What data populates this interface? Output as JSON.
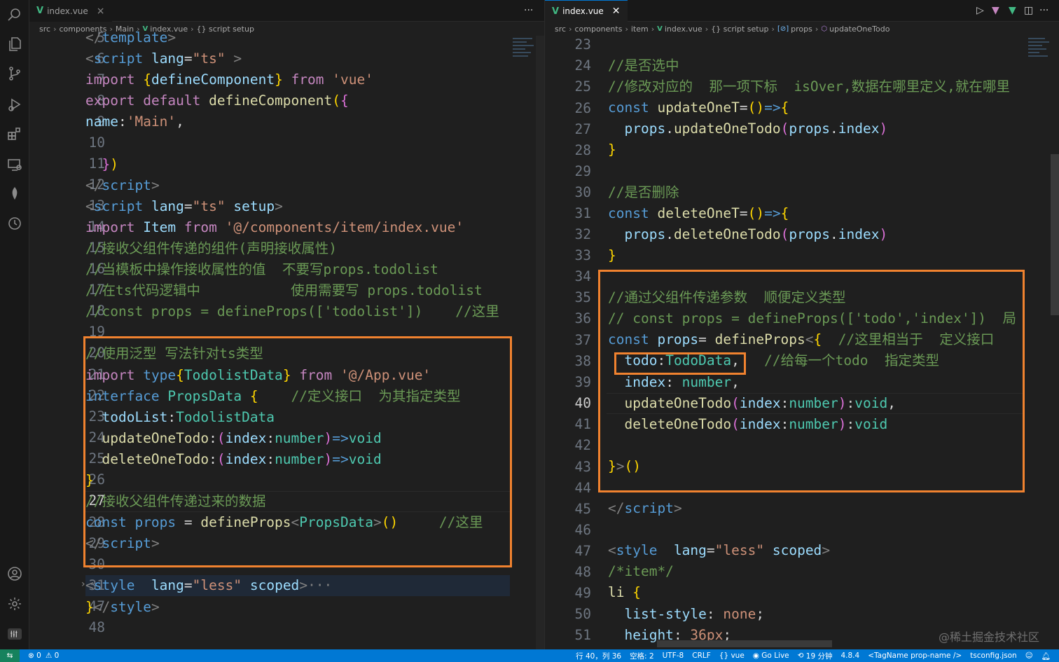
{
  "activity_bar": {
    "icons": [
      "search-icon",
      "files-icon",
      "source-control-icon",
      "run-debug-icon",
      "extensions-icon",
      "remote-explorer-icon",
      "mongodb-leaf-icon",
      "timeline-icon",
      "account-icon",
      "settings-gear-icon",
      "remote-indicator-icon"
    ]
  },
  "left": {
    "tab": {
      "label": "index.vue",
      "close": "×"
    },
    "tab_actions": "···",
    "breadcrumb": [
      "src",
      "components",
      "Main",
      "index.vue",
      "{} script setup"
    ],
    "line_numbers": [
      "5",
      "6",
      "7",
      "8",
      "9",
      "10",
      "11",
      "12",
      "13",
      "14",
      "15",
      "16",
      "17",
      "18",
      "19",
      "20",
      "21",
      "22",
      "23",
      "24",
      "25",
      "26",
      "27",
      "28",
      "29",
      "30",
      "31",
      "47",
      "48"
    ],
    "current_line": "27"
  },
  "right": {
    "tab": {
      "label": "index.vue",
      "close": "✕"
    },
    "breadcrumb": [
      "src",
      "components",
      "item",
      "index.vue",
      "{} script setup",
      "props",
      "updateOneTodo"
    ],
    "line_numbers": [
      "23",
      "24",
      "25",
      "26",
      "27",
      "28",
      "29",
      "30",
      "31",
      "32",
      "33",
      "34",
      "35",
      "36",
      "37",
      "38",
      "39",
      "40",
      "41",
      "42",
      "43",
      "44",
      "45",
      "46",
      "47",
      "48",
      "49",
      "50",
      "51"
    ],
    "current_line": "40"
  },
  "toolbar": {
    "run": "▷",
    "split": "◫",
    "more": "···"
  },
  "status": {
    "errors": "⊗ 0",
    "warnings": "⚠ 0",
    "position": "行 40，列 36",
    "indent": "空格: 2",
    "encoding": "UTF-8",
    "eol": "CRLF",
    "language": "{} vue",
    "golive": "Go Live",
    "time": "19 分钟",
    "version": "4.8.4",
    "tag": "<TagName prop-name />",
    "tsconfig": "tsconfig.json"
  },
  "watermark": "@稀土掘金技术社区",
  "colors": {
    "highlight_box": "#f0822f",
    "status_bar": "#0078d4",
    "editor_bg": "#1f1f1f"
  }
}
